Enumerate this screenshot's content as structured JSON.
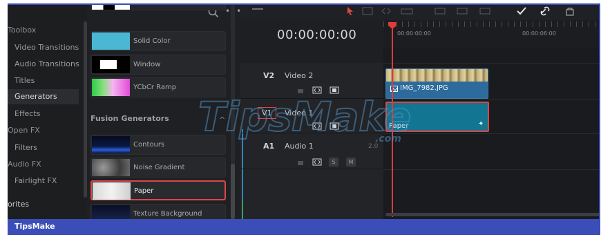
{
  "sidebar": {
    "items": [
      {
        "label": "Toolbox",
        "type": "category"
      },
      {
        "label": "Video Transitions",
        "type": "item"
      },
      {
        "label": "Audio Transitions",
        "type": "item"
      },
      {
        "label": "Titles",
        "type": "item"
      },
      {
        "label": "Generators",
        "type": "item",
        "selected": true
      },
      {
        "label": "Effects",
        "type": "item"
      },
      {
        "label": "Open FX",
        "type": "category"
      },
      {
        "label": "Filters",
        "type": "item"
      },
      {
        "label": "Audio FX",
        "type": "category"
      },
      {
        "label": "Fairlight FX",
        "type": "item"
      },
      {
        "label": "orites",
        "type": "category"
      }
    ]
  },
  "generators": {
    "items": [
      {
        "label": "Solid Color",
        "thumb": "solid-color"
      },
      {
        "label": "Window",
        "thumb": "window"
      },
      {
        "label": "YCbCr Ramp",
        "thumb": "ycbcr-ramp"
      }
    ],
    "fusion_header": "Fusion Generators",
    "fusion_items": [
      {
        "label": "Contours",
        "thumb": "contours"
      },
      {
        "label": "Noise Gradient",
        "thumb": "noise-gradient"
      },
      {
        "label": "Paper",
        "thumb": "paper",
        "selected": true
      },
      {
        "label": "Texture Background",
        "thumb": "texture-background"
      }
    ]
  },
  "timeline": {
    "timecode": "00:00:00:00",
    "ruler": [
      "00:00:00:00",
      "00:00:06:00"
    ],
    "tracks": [
      {
        "id": "V2",
        "name": "Video 2"
      },
      {
        "id": "V1",
        "name": "Video 1"
      },
      {
        "id": "A1",
        "name": "Audio 1",
        "level": "2.0"
      }
    ],
    "audio_buttons": {
      "solo": "S",
      "mute": "M"
    },
    "clips": {
      "image": "IMG_7982.JPG",
      "generator": "Paper"
    }
  },
  "watermark": {
    "main": "TipsMake",
    "suffix": ".com"
  },
  "footer": {
    "label": "TipsMake"
  },
  "colors": {
    "accent": "#3b4eb8",
    "selection": "#d94848",
    "clip_blue": "#2d6b9c",
    "clip_teal": "#127591"
  }
}
